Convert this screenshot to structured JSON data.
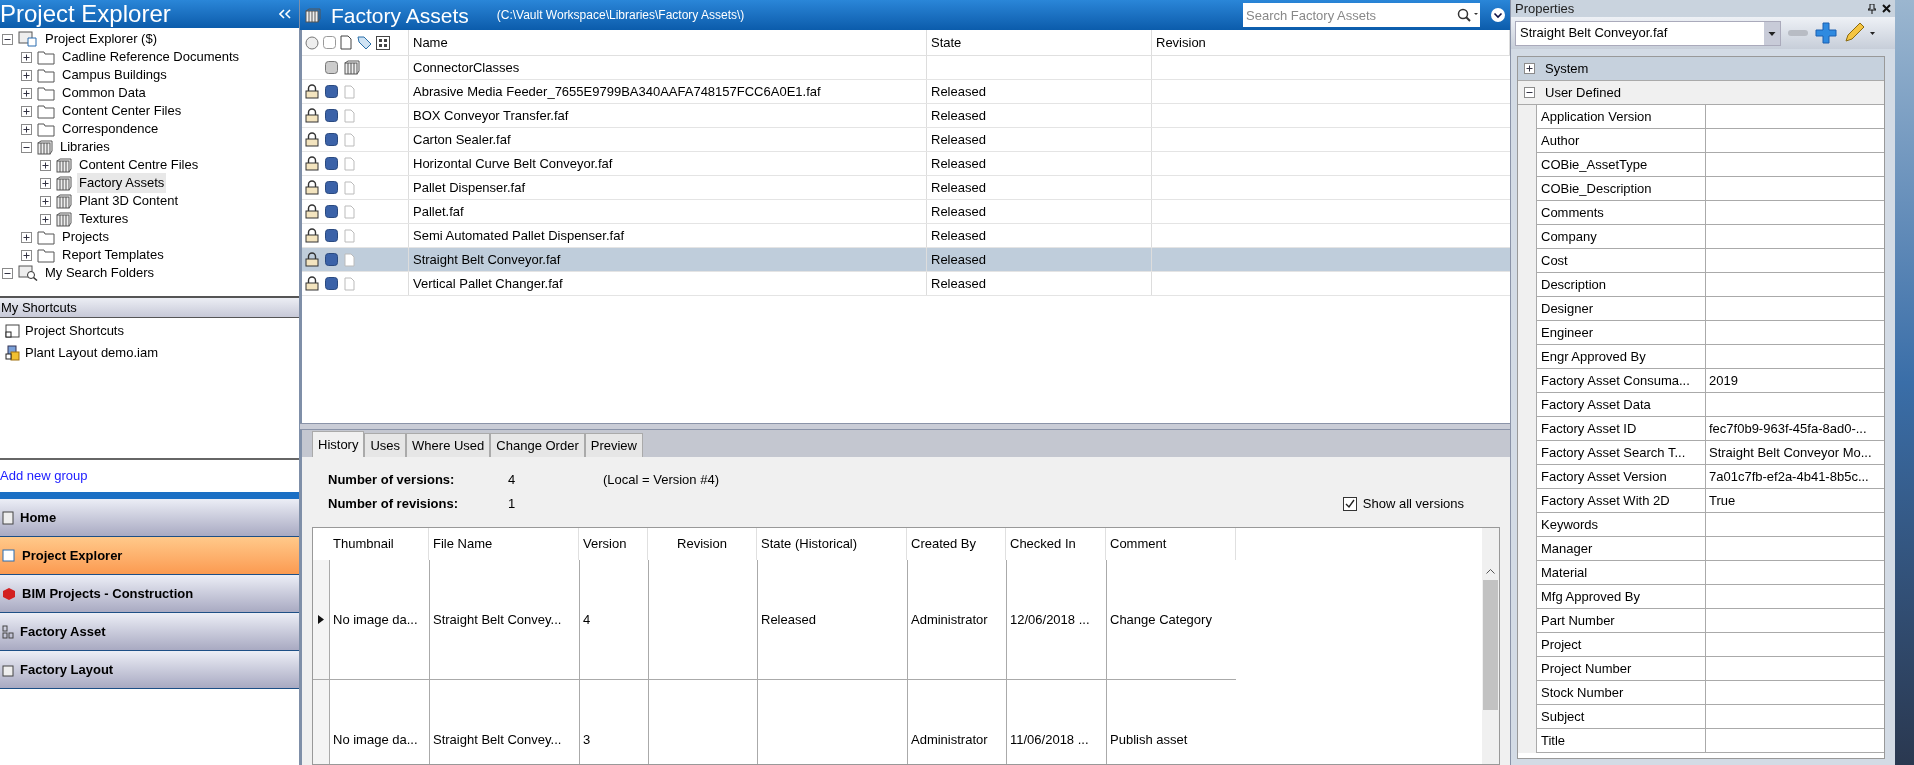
{
  "sidebar": {
    "title": "Project Explorer",
    "tree": [
      {
        "label": "Project Explorer ($)",
        "kind": "project",
        "expanded": true,
        "selected": false,
        "children": [
          {
            "label": "Cadline Reference Documents",
            "kind": "folder",
            "expanded": false,
            "selected": false
          },
          {
            "label": "Campus Buildings",
            "kind": "folder",
            "expanded": false,
            "selected": false
          },
          {
            "label": "Common Data",
            "kind": "folder",
            "expanded": false,
            "selected": false
          },
          {
            "label": "Content Center Files",
            "kind": "folder",
            "expanded": false,
            "selected": false
          },
          {
            "label": "Correspondence",
            "kind": "folder",
            "expanded": false,
            "selected": false
          },
          {
            "label": "Libraries",
            "kind": "library",
            "expanded": true,
            "selected": false,
            "children": [
              {
                "label": "Content Centre Files",
                "kind": "library",
                "expanded": false,
                "selected": false
              },
              {
                "label": "Factory Assets",
                "kind": "library",
                "expanded": false,
                "selected": true
              },
              {
                "label": "Plant 3D Content",
                "kind": "library",
                "expanded": false,
                "selected": false
              },
              {
                "label": "Textures",
                "kind": "library",
                "expanded": false,
                "selected": false
              }
            ]
          },
          {
            "label": "Projects",
            "kind": "folder",
            "expanded": false,
            "selected": false
          },
          {
            "label": "Report Templates",
            "kind": "folder",
            "expanded": false,
            "selected": false
          }
        ]
      },
      {
        "label": "My Search Folders",
        "kind": "search",
        "expanded": true,
        "selected": false
      }
    ]
  },
  "shortcuts": {
    "title": "My Shortcuts",
    "items": [
      {
        "label": "Project Shortcuts",
        "kind": "folder"
      },
      {
        "label": "Plant Layout demo.iam",
        "kind": "assembly"
      }
    ],
    "add_link": "Add new group"
  },
  "nav": [
    {
      "label": "Home",
      "selected": false
    },
    {
      "label": "Project Explorer",
      "selected": true
    },
    {
      "label": "BIM Projects - Construction",
      "selected": false
    },
    {
      "label": "Factory Asset",
      "selected": false
    },
    {
      "label": "Factory Layout",
      "selected": false
    }
  ],
  "main": {
    "title": "Factory Assets",
    "path": "(C:\\Vault Workspace\\Libraries\\Factory Assets\\)",
    "search": {
      "placeholder": "Search Factory Assets"
    },
    "columns": [
      "Name",
      "State",
      "Revision"
    ],
    "rows": [
      {
        "kind": "folder",
        "name": "ConnectorClasses",
        "selected": false
      },
      {
        "kind": "file",
        "name": "Abrasive Media Feeder_7655E9799BA340AAFA748157FCC6A0E1.faf",
        "state": "Released",
        "selected": false
      },
      {
        "kind": "file",
        "name": "BOX Conveyor Transfer.faf",
        "state": "Released",
        "selected": false
      },
      {
        "kind": "file",
        "name": "Carton Sealer.faf",
        "state": "Released",
        "selected": false
      },
      {
        "kind": "file",
        "name": "Horizontal Curve Belt Conveyor.faf",
        "state": "Released",
        "selected": false
      },
      {
        "kind": "file",
        "name": "Pallet Dispenser.faf",
        "state": "Released",
        "selected": false
      },
      {
        "kind": "file",
        "name": "Pallet.faf",
        "state": "Released",
        "selected": false
      },
      {
        "kind": "file",
        "name": "Semi Automated Pallet Dispenser.faf",
        "state": "Released",
        "selected": false
      },
      {
        "kind": "file",
        "name": "Straight Belt Conveyor.faf",
        "state": "Released",
        "selected": true
      },
      {
        "kind": "file",
        "name": "Vertical Pallet Changer.faf",
        "state": "Released",
        "selected": false
      }
    ]
  },
  "details": {
    "tabs": [
      {
        "label": "History",
        "selected": true
      },
      {
        "label": "Uses",
        "selected": false
      },
      {
        "label": "Where Used",
        "selected": false
      },
      {
        "label": "Change Order",
        "selected": false
      },
      {
        "label": "Preview",
        "selected": false
      }
    ],
    "versions_label": "Number of versions:",
    "versions_value": "4",
    "local_note": "(Local = Version #4)",
    "revisions_label": "Number of revisions:",
    "revisions_value": "1",
    "show_all": {
      "label": "Show all versions",
      "checked": true
    },
    "history": {
      "columns": [
        "Thumbnail",
        "File Name",
        "Version",
        "Revision",
        "State (Historical)",
        "Created By",
        "Checked In",
        "Comment"
      ],
      "rows": [
        {
          "selected": true,
          "thumbnail": "No image da...",
          "file_name": "Straight Belt Convey...",
          "version": "4",
          "state": "Released",
          "created_by": "Administrator",
          "checked_in": "12/06/2018 ...",
          "comment": "Change Category"
        },
        {
          "selected": false,
          "thumbnail": "No image da...",
          "file_name": "Straight Belt Convey...",
          "version": "3",
          "created_by": "Administrator",
          "checked_in": "11/06/2018 ...",
          "comment": "Publish asset"
        }
      ]
    }
  },
  "properties": {
    "title": "Properties",
    "selector": "Straight Belt Conveyor.faf",
    "groups": [
      {
        "label": "System",
        "expanded": false
      },
      {
        "label": "User Defined",
        "expanded": true,
        "rows": [
          {
            "name": "Application Version"
          },
          {
            "name": "Author"
          },
          {
            "name": "COBie_AssetType"
          },
          {
            "name": "COBie_Description"
          },
          {
            "name": "Comments"
          },
          {
            "name": "Company"
          },
          {
            "name": "Cost"
          },
          {
            "name": "Description"
          },
          {
            "name": "Designer"
          },
          {
            "name": "Engineer"
          },
          {
            "name": "Engr Approved By"
          },
          {
            "name": "Factory Asset Consuma...",
            "value": "2019"
          },
          {
            "name": "Factory Asset Data"
          },
          {
            "name": "Factory Asset ID",
            "value": "fec7f0b9-963f-45fa-8ad0-..."
          },
          {
            "name": "Factory Asset Search T...",
            "value": "Straight Belt Conveyor Mo..."
          },
          {
            "name": "Factory Asset Version",
            "value": "7a01c7fb-ef2a-4b41-8b5c..."
          },
          {
            "name": "Factory Asset With 2D",
            "value": "True"
          },
          {
            "name": "Keywords"
          },
          {
            "name": "Manager"
          },
          {
            "name": "Material"
          },
          {
            "name": "Mfg Approved By"
          },
          {
            "name": "Part Number"
          },
          {
            "name": "Project"
          },
          {
            "name": "Project Number"
          },
          {
            "name": "Stock Number"
          },
          {
            "name": "Subject"
          },
          {
            "name": "Title"
          }
        ]
      }
    ]
  }
}
